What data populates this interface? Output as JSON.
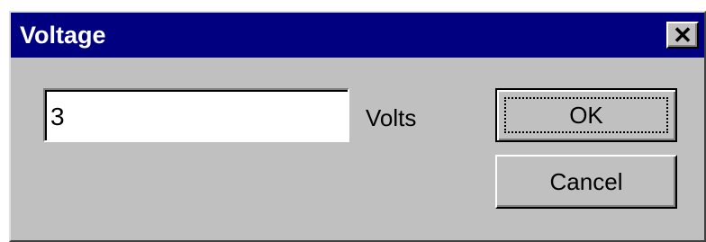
{
  "dialog": {
    "title": "Voltage",
    "close_icon": "close-icon",
    "close_glyph": "✕"
  },
  "input": {
    "value": "3"
  },
  "unit_label": "Volts",
  "buttons": {
    "ok_label": "OK",
    "cancel_label": "Cancel"
  },
  "colors": {
    "titlebar": "#000080",
    "dialog_face": "#c0c0c0",
    "title_text": "#ffffff"
  }
}
